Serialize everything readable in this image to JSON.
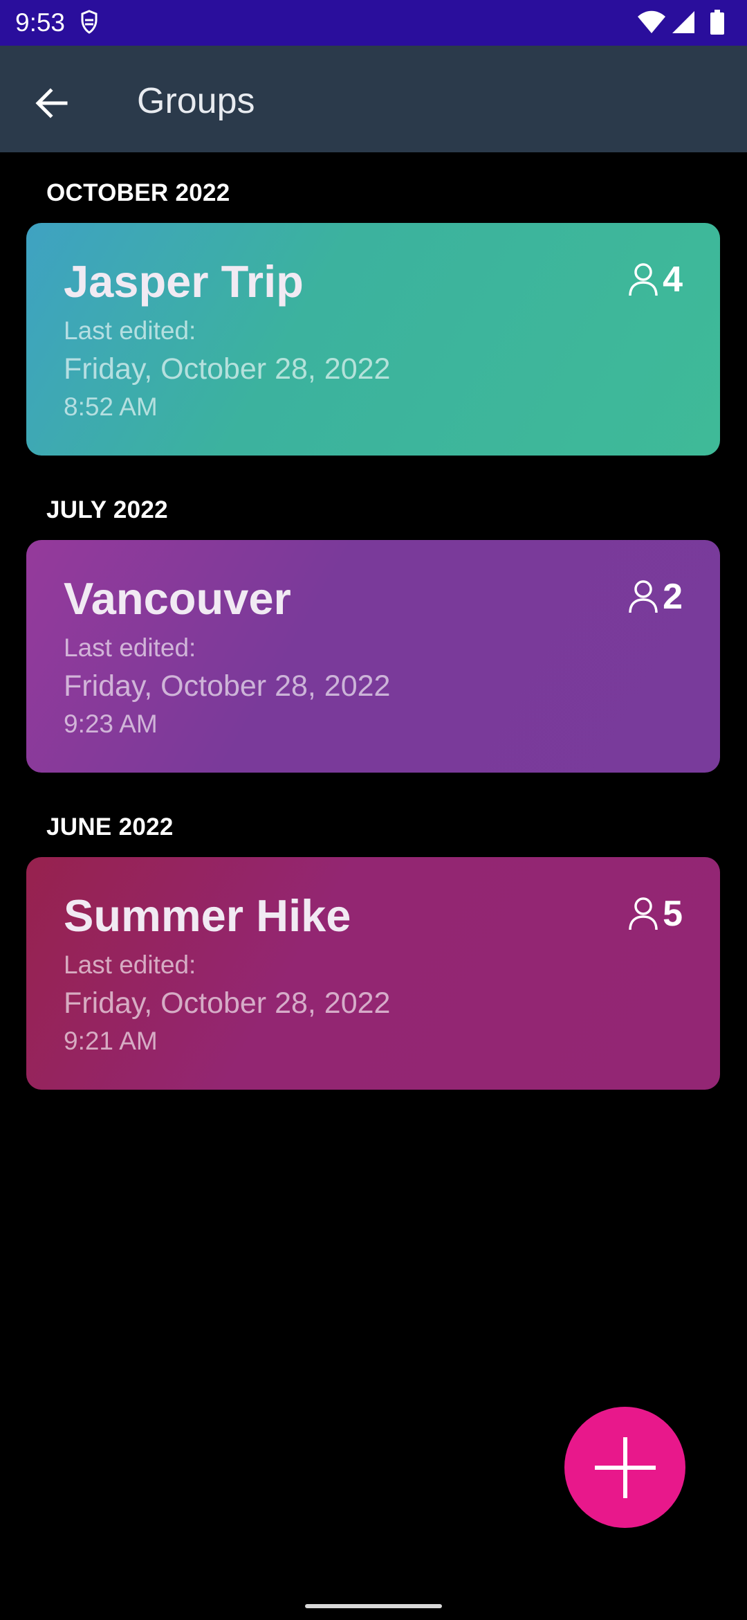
{
  "status_bar": {
    "time": "9:53",
    "icons": [
      "shield-alert-icon",
      "wifi-icon",
      "signal-icon",
      "battery-icon"
    ],
    "color": "#2a0e9c"
  },
  "app_bar": {
    "back_icon": "arrow-left-icon",
    "title": "Groups",
    "color": "#2b3a4b"
  },
  "sections": [
    {
      "header": "OCTOBER 2022",
      "groups": [
        {
          "name": "Jasper Trip",
          "edited_label": "Last edited:",
          "date": "Friday, October 28, 2022",
          "time": "8:52 AM",
          "members": "4",
          "color": "#3fba98"
        }
      ]
    },
    {
      "header": "JULY 2022",
      "groups": [
        {
          "name": "Vancouver",
          "edited_label": "Last edited:",
          "date": "Friday, October 28, 2022",
          "time": "9:23 AM",
          "members": "2",
          "color": "#793b9b"
        }
      ]
    },
    {
      "header": "JUNE 2022",
      "groups": [
        {
          "name": "Summer Hike",
          "edited_label": "Last edited:",
          "date": "Friday, October 28, 2022",
          "time": "9:21 AM",
          "members": "5",
          "color": "#932674"
        }
      ]
    }
  ],
  "fab": {
    "icon": "plus-icon",
    "color": "#e8188b"
  }
}
